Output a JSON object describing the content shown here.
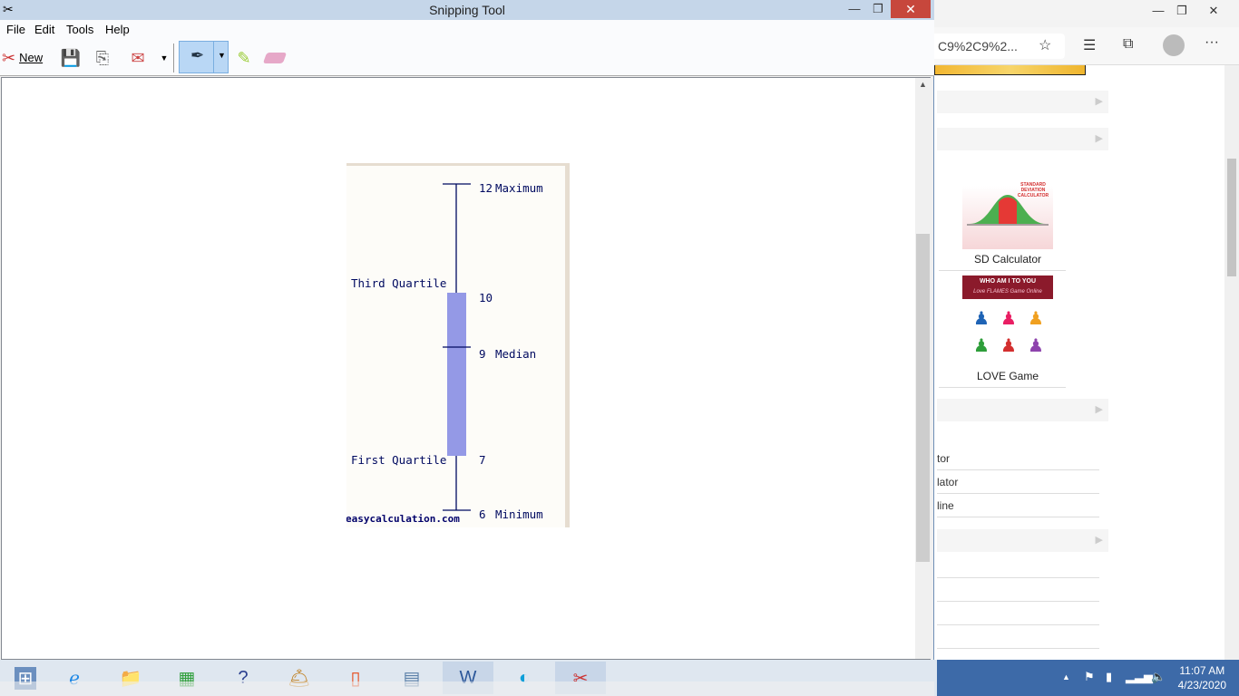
{
  "browser": {
    "address_text": "C9%2C9%2...",
    "window_buttons": {
      "minimize": "—",
      "maximize": "❐",
      "close": "✕"
    },
    "icons": [
      "star-add-icon",
      "favorites-icon",
      "collections-icon",
      "profile-icon",
      "more-icon"
    ],
    "more_label": "···",
    "thumbnails": [
      {
        "label": "SD Calculator",
        "image_title": "STANDARD DEVIATION CALCULATOR"
      },
      {
        "label": "LOVE Game",
        "image_title": "WHO AM I TO YOU",
        "image_subtitle": "Love FLAMES Game Online"
      }
    ],
    "list_items": [
      "tor",
      "lator",
      "line"
    ]
  },
  "snipping": {
    "title": "Snipping Tool",
    "menu": [
      "File",
      "Edit",
      "Tools",
      "Help"
    ],
    "toolbar": {
      "new_label": "New"
    },
    "window_buttons": {
      "minimize": "—",
      "maximize": "❐",
      "close": "✕"
    }
  },
  "boxplot": {
    "minimum": 6,
    "first_quartile": 7,
    "median": 9,
    "third_quartile": 10,
    "maximum": 12,
    "labels": {
      "maximum": "Maximum",
      "median": "Median",
      "minimum": "Minimum",
      "third_quartile": "Third Quartile",
      "first_quartile": "First Quartile"
    },
    "values_text": {
      "maximum": "12",
      "third_quartile": "10",
      "median": "9",
      "first_quartile": "7",
      "minimum": "6"
    },
    "watermark": "easycalculation.com",
    "box_color": "#9499e6",
    "line_color": "#000a60"
  },
  "taskbar": {
    "time": "11:07 AM",
    "date": "4/23/2020",
    "apps": [
      "start",
      "internet-explorer",
      "file-explorer",
      "store",
      "help",
      "tips",
      "office",
      "calculator",
      "word",
      "edge",
      "snipping-tool"
    ]
  }
}
